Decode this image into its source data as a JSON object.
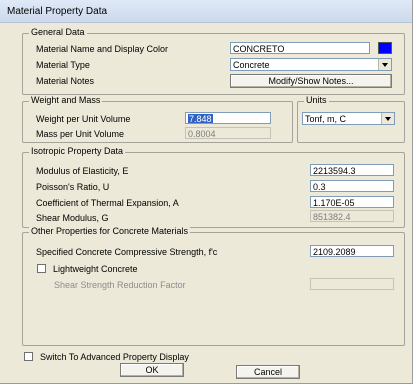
{
  "window": {
    "title": "Material Property Data"
  },
  "general": {
    "legend": "General Data",
    "name_label": "Material Name and Display Color",
    "name_value": "CONCRETO",
    "color": "#0000ff",
    "type_label": "Material Type",
    "type_value": "Concrete",
    "notes_label": "Material Notes",
    "notes_button": "Modify/Show Notes..."
  },
  "weight": {
    "legend": "Weight and Mass",
    "wpv_label": "Weight per Unit Volume",
    "wpv_value": "7.848",
    "mpv_label": "Mass per Unit Volume",
    "mpv_value": "0.8004"
  },
  "units": {
    "legend": "Units",
    "value": "Tonf, m, C"
  },
  "iso": {
    "legend": "Isotropic Property Data",
    "e_label": "Modulus of Elasticity,  E",
    "e_value": "2213594.3",
    "u_label": "Poisson's Ratio,  U",
    "u_value": "0.3",
    "a_label": "Coefficient of Thermal Expansion,  A",
    "a_value": "1.170E-05",
    "g_label": "Shear Modulus,  G",
    "g_value": "851382.4"
  },
  "other": {
    "legend": "Other Properties for Concrete Materials",
    "fc_label": "Specified Concrete Compressive Strength, f'c",
    "fc_value": "2109.2089",
    "lw_label": "Lightweight Concrete",
    "ssrf_label": "Shear Strength Reduction Factor",
    "ssrf_value": ""
  },
  "footer": {
    "advanced_label": "Switch To Advanced Property Display",
    "ok": "OK",
    "cancel": "Cancel"
  }
}
